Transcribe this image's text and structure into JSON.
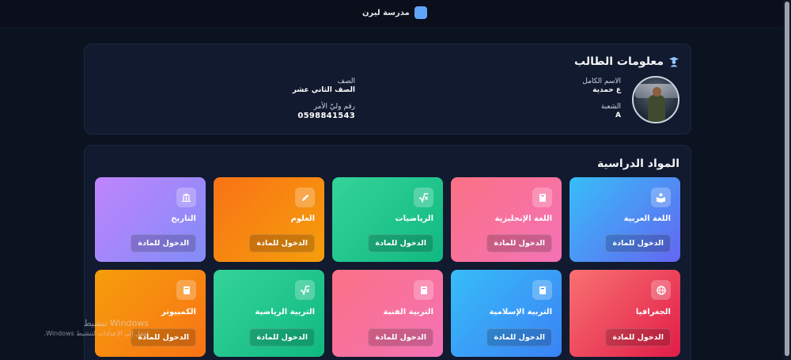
{
  "header": {
    "school_name": "مدرسة ليرن",
    "logo_color": "#60a5fa"
  },
  "student_info": {
    "title": "معلومات الطالب",
    "title_icon": "graduate-icon",
    "full_name_label": "الاسم الكامل",
    "full_name_value": "ع حمدية",
    "branch_label": "الشعبة",
    "branch_value": "A",
    "grade_label": "الصف",
    "grade_value": "الصف الثاني عشر",
    "guardian_label": "رقم وليّ الأمر",
    "guardian_value": "0598841543"
  },
  "subjects": {
    "title": "المواد الدراسية",
    "items": [
      {
        "name": "اللغة العربية",
        "button": "الدخول للمادة",
        "icon": "book-reader-icon"
      },
      {
        "name": "اللغة الإنجليزية",
        "button": "الدخول للمادة",
        "icon": "book-icon"
      },
      {
        "name": "الرياضيات",
        "button": "الدخول للمادة",
        "icon": "square-root-icon"
      },
      {
        "name": "العلوم",
        "button": "الدخول للمادة",
        "icon": "pencil-icon"
      },
      {
        "name": "التاريخ",
        "button": "الدخول للمادة",
        "icon": "landmark-icon"
      },
      {
        "name": "الجغرافيا",
        "button": "الدخول للمادة",
        "icon": "globe-icon"
      },
      {
        "name": "التربية الإسلامية",
        "button": "الدخول للمادة",
        "icon": "book-icon"
      },
      {
        "name": "التربية الفنية",
        "button": "الدخول للمادة",
        "icon": "book-icon"
      },
      {
        "name": "التربية الرياضية",
        "button": "الدخول للمادة",
        "icon": "square-root-icon"
      },
      {
        "name": "الكمبيوتر",
        "button": "الدخول للمادة",
        "icon": "book-icon"
      }
    ]
  },
  "watermark": {
    "title": "Windows تنشيط",
    "subtitle": "انتقل إلى الإعدادات لتنشيط Windows."
  }
}
